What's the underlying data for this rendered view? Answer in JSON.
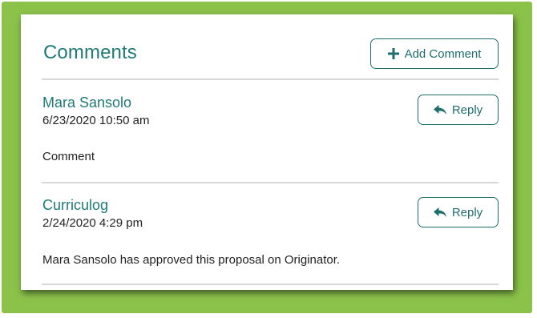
{
  "comments_panel": {
    "title": "Comments",
    "add_button_label": "Add Comment",
    "accent_color": "#1f7a74",
    "frame_color": "#8bc34a",
    "items": [
      {
        "author": "Mara Sansolo",
        "date": "6/23/2020 10:50 am",
        "body": "Comment",
        "reply_label": "Reply"
      },
      {
        "author": "Curriculog",
        "date": "2/24/2020 4:29 pm",
        "body": "Mara Sansolo has approved this proposal on Originator.",
        "reply_label": "Reply"
      }
    ]
  },
  "icons": {
    "add": "plus-icon",
    "reply": "reply-arrow-icon"
  }
}
